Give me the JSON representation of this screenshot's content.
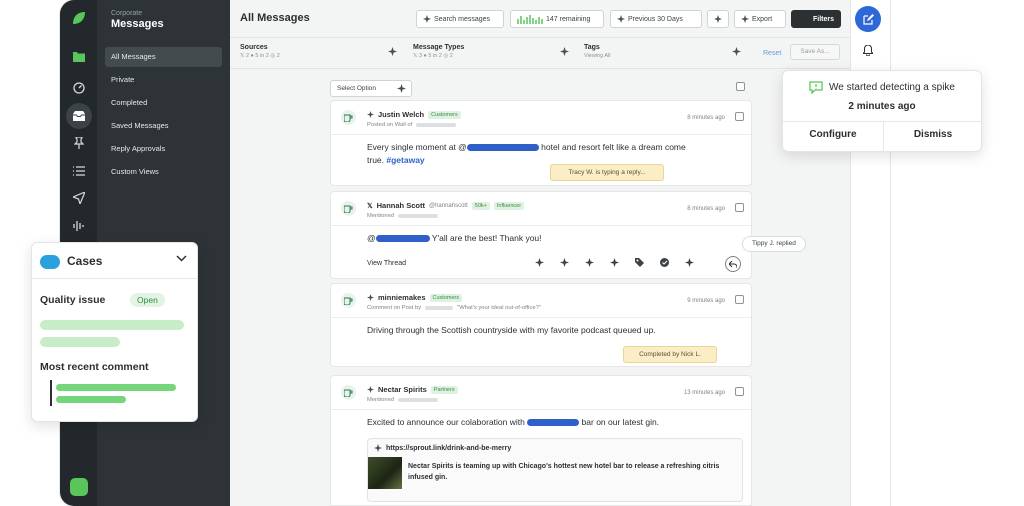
{
  "nav": {
    "context": "Corporate",
    "title": "Messages",
    "items": [
      {
        "label": "All Messages"
      },
      {
        "label": "Private"
      },
      {
        "label": "Completed"
      },
      {
        "label": "Saved Messages"
      },
      {
        "label": "Reply Approvals"
      },
      {
        "label": "Custom Views"
      }
    ]
  },
  "header": {
    "title": "All Messages",
    "search_label": "Search messages",
    "remaining_label": "147 remaining",
    "previous_label": "Previous 30 Days",
    "export_label": "Export",
    "filters_label": "Filters"
  },
  "filters": {
    "sources_label": "Sources",
    "sources_counts": "𝕏 2   ● 5   in 2   ◎ 2",
    "types_label": "Message Types",
    "types_counts": "𝕏 3   ● 5   in 2   ◎ 2",
    "tags_label": "Tags",
    "tags_sub": "Viewing All",
    "reset_label": "Reset",
    "save_label": "Save As..."
  },
  "select_option_label": "Select Option",
  "messages": [
    {
      "name": "Justin Welch",
      "tag": "Customers",
      "sub": "Posted on Wall of",
      "time": "8 minutes ago",
      "text_before": "Every single moment at @",
      "text_after": " hotel and resort felt like a dream come",
      "text_line2": "true. ",
      "hashtag": "#getaway",
      "note": "Tracy W. is typing a reply..."
    },
    {
      "name": "Hannah Scott",
      "handle": "@hannahscott",
      "tag1": "50k+",
      "tag2": "Influencer",
      "sub": "Mentioned",
      "time": "8 minutes ago",
      "text_before": "@",
      "text_after": " Y'all are the best! Thank you!",
      "view_thread": "View Thread",
      "tooltip": "Tippy J. replied"
    },
    {
      "name": "minniemakes",
      "tag": "Customers",
      "sub": "Comment on Post by",
      "sub_quote": "\"What's your ideal out-of-office?\"",
      "time": "9 minutes ago",
      "text": "Driving through the Scottish countryside with my favorite podcast queued up.",
      "note": "Completed by Nick L."
    },
    {
      "name": "Nectar Spirits",
      "tag": "Partners",
      "sub": "Mentioned",
      "time": "13 minutes ago",
      "text_before": "Excited to announce our colaboration with ",
      "text_after": " bar on our latest gin.",
      "link_url": "https://sprout.link/drink-and-be-merry",
      "link_desc": "Nectar Spirits is teaming up with Chicago's hottest new hotel bar to release a refreshing citris infused gin."
    }
  ],
  "spike": {
    "message": "We started detecting a spike",
    "ago": "2 minutes ago",
    "configure": "Configure",
    "dismiss": "Dismiss"
  },
  "cases": {
    "title": "Cases",
    "issue": "Quality issue",
    "status": "Open",
    "recent_comment": "Most recent comment"
  },
  "colors": {
    "accent": "#2e67d6",
    "brand_green": "#59c55b",
    "sidebar": "#2d3336"
  }
}
